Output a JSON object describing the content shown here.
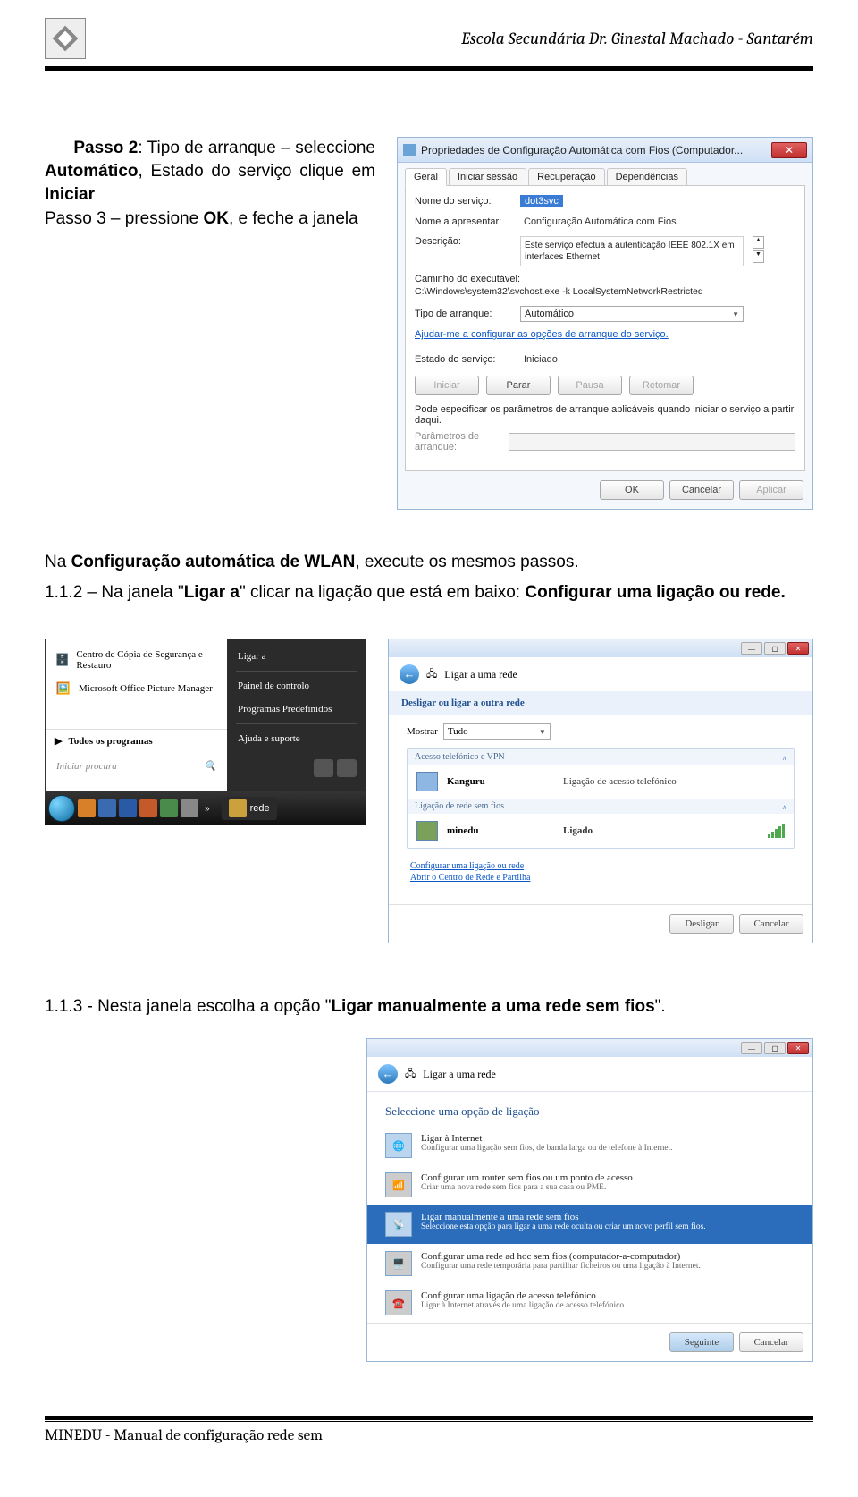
{
  "header": {
    "school": "Escola Secundária Dr. Ginestal Machado - Santarém"
  },
  "passo2": {
    "line1a": "Passo 2",
    "line1b": ": Tipo de arranque – seleccione ",
    "line1c": "Automático",
    "line1d": ", Estado do serviço clique em ",
    "line1e": "Iniciar",
    "line2a": "Passo 3 – pressione ",
    "line2b": "OK",
    "line2c": ", e feche a janela"
  },
  "dlg": {
    "title": "Propriedades de Configuração Automática com Fios (Computador...",
    "tabs": [
      "Geral",
      "Iniciar sessão",
      "Recuperação",
      "Dependências"
    ],
    "l_nome": "Nome do serviço:",
    "v_nome": "dot3svc",
    "l_nomeap": "Nome a apresentar:",
    "v_nomeap": "Configuração Automática com Fios",
    "l_desc": "Descrição:",
    "v_desc": "Este serviço efectua a autenticação IEEE 802.1X em interfaces Ethernet",
    "l_path": "Caminho do executável:",
    "v_path": "C:\\Windows\\system32\\svchost.exe -k LocalSystemNetworkRestricted",
    "l_tipo": "Tipo de arranque:",
    "v_tipo": "Automático",
    "helplink": "Ajudar-me a configurar as opções de arranque do serviço.",
    "l_estado": "Estado do serviço:",
    "v_estado": "Iniciado",
    "b_iniciar": "Iniciar",
    "b_parar": "Parar",
    "b_pausa": "Pausa",
    "b_retomar": "Retomar",
    "note": "Pode especificar os parâmetros de arranque aplicáveis quando iniciar o serviço a partir daqui.",
    "l_param": "Parâmetros de arranque:",
    "b_ok": "OK",
    "b_cancel": "Cancelar",
    "b_apply": "Aplicar"
  },
  "mid": {
    "line": "Na ",
    "b": "Configuração automática de WLAN",
    "rest": ", execute os mesmos passos."
  },
  "mid2": {
    "a": "1.1.2 – Na janela \"",
    "b": "Ligar a",
    "c": "\" clicar na ligação que está em baixo: ",
    "d": "Configurar uma ligação ou rede."
  },
  "startmenu": {
    "left1": "Centro de Cópia de Segurança e Restauro",
    "left2": "Microsoft Office Picture Manager",
    "all": "Todos os programas",
    "right": [
      "Ligar a",
      "Painel de controlo",
      "Programas Predefinidos",
      "Ajuda e suporte"
    ],
    "search": "Iniciar procura",
    "task_label": "rede"
  },
  "net": {
    "title": "Ligar a uma rede",
    "bluehdr": "Desligar ou ligar a outra rede",
    "mostrar": "Mostrar",
    "tudo": "Tudo",
    "grp1": "Acesso telefónico e VPN",
    "c1": "Kanguru",
    "c1s": "Ligação de acesso telefónico",
    "grp2": "Ligação de rede sem fios",
    "c2": "minedu",
    "c2s": "Ligado",
    "link1": "Configurar uma ligação ou rede",
    "link2": "Abrir o Centro de Rede e Partilha",
    "b_des": "Desligar",
    "b_can": "Cancelar"
  },
  "txt3": {
    "a": "1.1.3 - Nesta janela escolha a opção \"",
    "b": "Ligar manualmente a uma rede sem fios",
    "c": "\"."
  },
  "wiz": {
    "title": "Ligar a uma rede",
    "hdr": "Seleccione uma opção de ligação",
    "o1h": "Ligar à Internet",
    "o1d": "Configurar uma ligação sem fios, de banda larga ou de telefone à Internet.",
    "o2h": "Configurar um router sem fios ou um ponto de acesso",
    "o2d": "Criar uma nova rede sem fios para a sua casa ou PME.",
    "o3h": "Ligar manualmente a uma rede sem fios",
    "o3d": "Seleccione esta opção para ligar a uma rede oculta ou criar um novo perfil sem fios.",
    "o4h": "Configurar uma rede ad hoc sem fios (computador-a-computador)",
    "o4d": "Configurar uma rede temporária para partilhar ficheiros ou uma ligação à Internet.",
    "o5h": "Configurar uma ligação de acesso telefónico",
    "o5d": "Ligar à Internet através de uma ligação de acesso telefónico.",
    "b_next": "Seguinte",
    "b_cancel": "Cancelar"
  },
  "footer": {
    "text": "MINEDU - Manual de configuração rede sem"
  }
}
